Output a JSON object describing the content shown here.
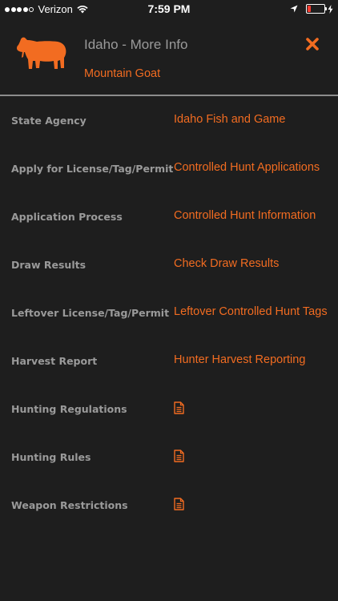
{
  "status_bar": {
    "carrier": "Verizon",
    "time": "7:59 PM",
    "signal_bars": 4,
    "signal_total": 5,
    "battery_level": 0.2
  },
  "header": {
    "title": "Idaho - More Info",
    "subtitle": "Mountain Goat",
    "icon": "mountain-goat-icon",
    "close_icon": "close-icon"
  },
  "colors": {
    "accent": "#f26c21",
    "background": "#1e1e1e",
    "label": "#9a9a9a",
    "divider": "#8c8c8c"
  },
  "rows": [
    {
      "label": "State Agency",
      "value": "Idaho Fish and Game",
      "kind": "link"
    },
    {
      "label": "Apply for License/Tag/Permit",
      "value": "Controlled Hunt Applications",
      "kind": "link"
    },
    {
      "label": "Application Process",
      "value": "Controlled Hunt Information",
      "kind": "link"
    },
    {
      "label": "Draw Results",
      "value": "Check Draw Results",
      "kind": "link"
    },
    {
      "label": "Leftover License/Tag/Permit",
      "value": "Leftover Controlled Hunt Tags",
      "kind": "link"
    },
    {
      "label": "Harvest Report",
      "value": "Hunter Harvest Reporting",
      "kind": "link"
    },
    {
      "label": "Hunting Regulations",
      "value": "document-icon",
      "kind": "icon"
    },
    {
      "label": "Hunting Rules",
      "value": "document-icon",
      "kind": "icon"
    },
    {
      "label": "Weapon Restrictions",
      "value": "document-icon",
      "kind": "icon"
    }
  ]
}
